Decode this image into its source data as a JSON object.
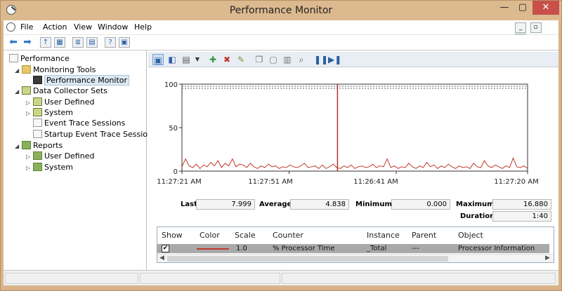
{
  "window": {
    "title": "Performance Monitor",
    "min": "—",
    "max": "▢",
    "close": "✕"
  },
  "menu": [
    "File",
    "Action",
    "View",
    "Window",
    "Help"
  ],
  "mdi": [
    "_",
    "▫",
    "×"
  ],
  "tree": [
    {
      "label": "Performance",
      "icon": "performance-icon"
    },
    {
      "label": "Monitoring Tools",
      "icon": "monitoring-tools-icon"
    },
    {
      "label": "Performance Monitor",
      "icon": "performance-monitor-icon"
    },
    {
      "label": "Data Collector Sets",
      "icon": "data-collector-sets-icon"
    },
    {
      "label": "User Defined",
      "icon": "user-defined-icon"
    },
    {
      "label": "System",
      "icon": "system-icon"
    },
    {
      "label": "Event Trace Sessions",
      "icon": "page-icon"
    },
    {
      "label": "Startup Event Trace Sessions",
      "icon": "page-icon"
    },
    {
      "label": "Reports",
      "icon": "reports-icon"
    },
    {
      "label": "User Defined",
      "icon": "user-defined-icon"
    },
    {
      "label": "System",
      "icon": "system-icon"
    }
  ],
  "stats": {
    "last_label": "Last",
    "last": "7.999",
    "average_label": "Average",
    "average": "4.838",
    "minimum_label": "Minimum",
    "minimum": "0.000",
    "maximum_label": "Maximum",
    "maximum": "16.880",
    "duration_label": "Duration",
    "duration": "1:40"
  },
  "table": {
    "headers": [
      "Show",
      "Color",
      "Scale",
      "Counter",
      "Instance",
      "Parent",
      "Object"
    ],
    "row": {
      "show": "✔",
      "scale": "1.0",
      "counter": "% Processor Time",
      "instance": "_Total",
      "parent": "---",
      "object": "Processor Information",
      "color": "#c0392b"
    }
  },
  "chart_data": {
    "type": "line",
    "x_tick_labels": [
      "11:27:21 AM",
      "11:27:51 AM",
      "11:26:41 AM",
      "11:27:20 AM"
    ],
    "y_ticks": [
      0,
      50,
      100
    ],
    "ylim": [
      0,
      100
    ],
    "grid": false,
    "cursor_fraction": 0.45,
    "series": [
      {
        "color": "#c0392b",
        "values": [
          5,
          14,
          6,
          4,
          8,
          3,
          7,
          5,
          10,
          6,
          12,
          4,
          9,
          6,
          14,
          5,
          8,
          7,
          4,
          9,
          5,
          3,
          6,
          4,
          8,
          5,
          6,
          3,
          5,
          4,
          7,
          5,
          4,
          6,
          9,
          4,
          5,
          6,
          3,
          7,
          3,
          5,
          8,
          4,
          3,
          6,
          4,
          7,
          3,
          5,
          6,
          4,
          5,
          8,
          4,
          6,
          5,
          14,
          4,
          6,
          3,
          5,
          4,
          9,
          5,
          3,
          6,
          4,
          10,
          5,
          7,
          3,
          6,
          4,
          8,
          5,
          3,
          6,
          4,
          5,
          3,
          9,
          5,
          4,
          12,
          6,
          4,
          7,
          5,
          3,
          6,
          4,
          15,
          5,
          4,
          6,
          3
        ]
      }
    ]
  }
}
